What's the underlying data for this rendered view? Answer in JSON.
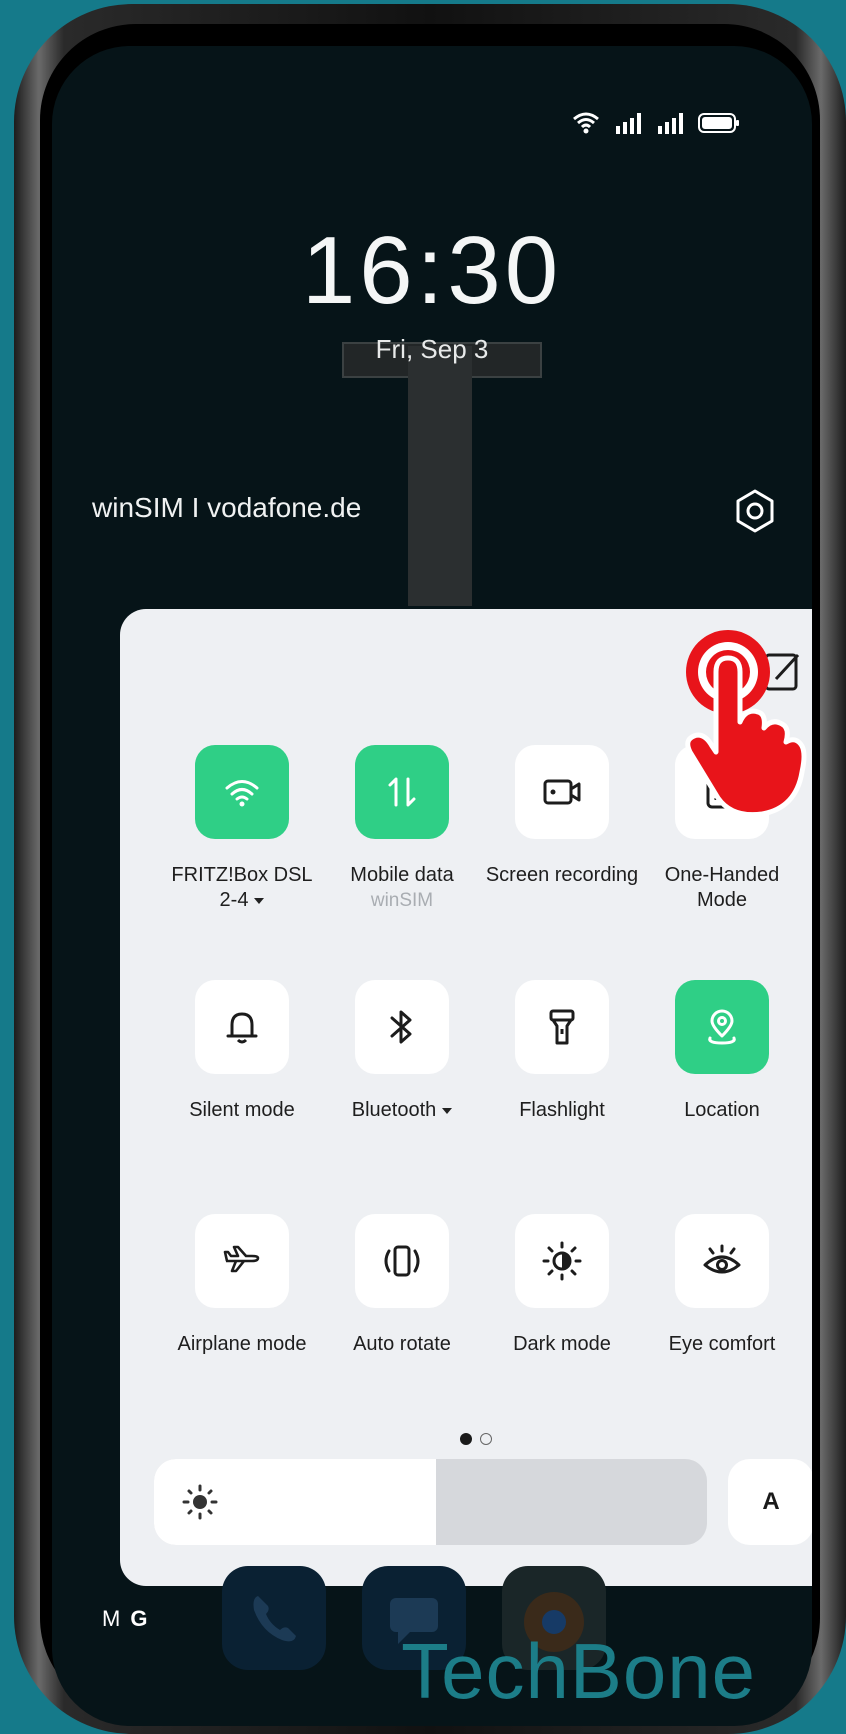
{
  "status_bar": {
    "icons": [
      "wifi-icon",
      "signal-sim1-icon",
      "signal-sim2-icon",
      "battery-icon"
    ]
  },
  "lockscreen": {
    "time": "16:30",
    "date": "Fri, Sep 3"
  },
  "carrier": "winSIM I vodafone.de",
  "quick_settings": {
    "tiles": [
      {
        "name": "wifi",
        "label": "FRITZ!Box DSL 2-4",
        "has_dropdown": true,
        "active": true,
        "icon": "wifi-icon"
      },
      {
        "name": "mobile-data",
        "label": "Mobile data",
        "sub": "winSIM",
        "active": true,
        "icon": "arrows-updown-icon"
      },
      {
        "name": "screen-recording",
        "label": "Screen recording",
        "active": false,
        "icon": "screen-record-icon"
      },
      {
        "name": "one-handed",
        "label": "One-Handed Mode",
        "active": false,
        "icon": "one-handed-icon"
      },
      {
        "name": "silent",
        "label": "Silent mode",
        "active": false,
        "icon": "bell-icon"
      },
      {
        "name": "bluetooth",
        "label": "Bluetooth",
        "has_dropdown": true,
        "active": false,
        "icon": "bluetooth-icon"
      },
      {
        "name": "flashlight",
        "label": "Flashlight",
        "active": false,
        "icon": "flashlight-icon"
      },
      {
        "name": "location",
        "label": "Location",
        "active": true,
        "icon": "location-icon"
      },
      {
        "name": "airplane",
        "label": "Airplane mode",
        "active": false,
        "icon": "airplane-icon"
      },
      {
        "name": "auto-rotate",
        "label": "Auto rotate",
        "active": false,
        "icon": "rotate-icon"
      },
      {
        "name": "dark-mode",
        "label": "Dark mode",
        "active": false,
        "icon": "dark-mode-icon"
      },
      {
        "name": "eye-comfort",
        "label": "Eye comfort",
        "active": false,
        "icon": "eye-icon"
      }
    ],
    "page_indicator": {
      "current": 1,
      "total": 2
    },
    "brightness": {
      "level": 0.51
    },
    "auto_brightness_label": "A"
  },
  "notification_icons": [
    "M",
    "G"
  ],
  "watermark": "TechBone",
  "colors": {
    "accent": "#2fcf86",
    "panel": "#eef0f3",
    "background": "#157a8a",
    "hand": "#e8141a"
  }
}
